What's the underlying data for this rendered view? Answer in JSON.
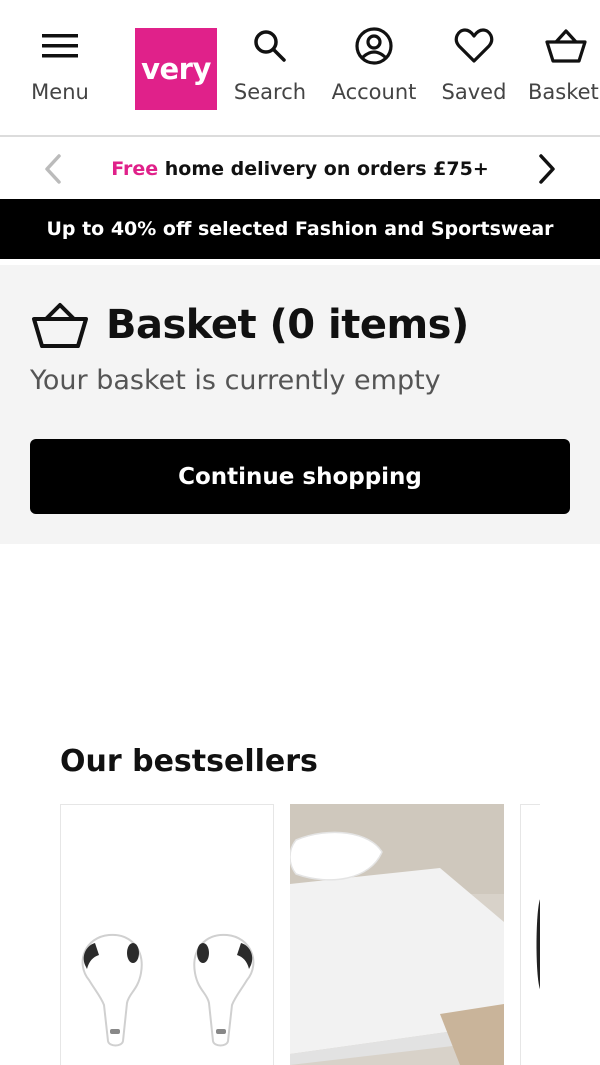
{
  "header": {
    "menu_label": "Menu",
    "logo_text": "very",
    "search_label": "Search",
    "account_label": "Account",
    "saved_label": "Saved",
    "basket_label": "Basket",
    "brand_color": "#e0218a"
  },
  "delivery_banner": {
    "free_text": "Free",
    "rest_text": " home delivery on orders £75+"
  },
  "promo_banner": {
    "text": "Up to 40% off selected Fashion and Sportswear"
  },
  "basket": {
    "title": "Basket (0 items)",
    "empty_message": "Your basket is currently empty",
    "continue_label": "Continue shopping"
  },
  "bestsellers": {
    "title": "Our bestsellers",
    "products": [
      {
        "image": "wireless-earbuds"
      },
      {
        "image": "bed-with-white-sheets"
      },
      {
        "image": "partial-product"
      }
    ]
  }
}
